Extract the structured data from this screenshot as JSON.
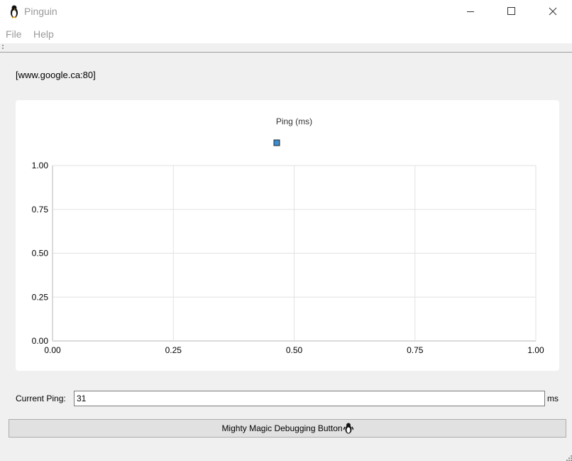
{
  "window": {
    "title": "Pinguin",
    "icon": "penguin-icon"
  },
  "menu": {
    "items": [
      "File",
      "Help"
    ]
  },
  "host": {
    "label": "[www.google.ca:80]"
  },
  "chart_data": {
    "type": "line",
    "title": "Ping (ms)",
    "series": [
      {
        "name": "",
        "values": []
      }
    ],
    "xlim": [
      0,
      1
    ],
    "ylim": [
      0,
      1
    ],
    "x_ticks": [
      "0.00",
      "0.25",
      "0.50",
      "0.75",
      "1.00"
    ],
    "y_ticks": [
      "0.00",
      "0.25",
      "0.50",
      "0.75",
      "1.00"
    ],
    "grid": true,
    "legend": "top-center",
    "series_color": "#3a8fd4"
  },
  "ping": {
    "label": "Current Ping:",
    "value": "31",
    "unit": "ms"
  },
  "debug_button": {
    "label": "Mighty Magic Debugging Button",
    "icon": "penguin-icon"
  }
}
